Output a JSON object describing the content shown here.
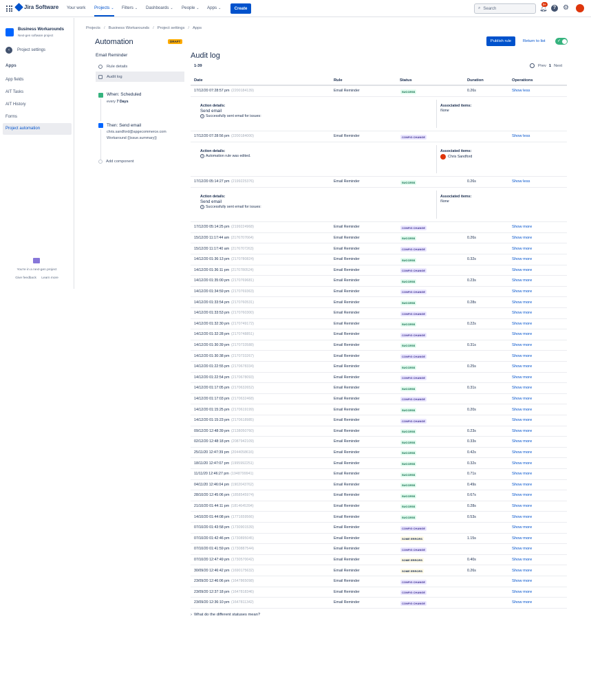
{
  "topnav": {
    "app_name": "Jira Software",
    "items": [
      {
        "label": "Your work",
        "caret": false
      },
      {
        "label": "Projects",
        "caret": true,
        "active": true
      },
      {
        "label": "Filters",
        "caret": true
      },
      {
        "label": "Dashboards",
        "caret": true
      },
      {
        "label": "People",
        "caret": true
      },
      {
        "label": "Apps",
        "caret": true
      }
    ],
    "create_label": "Create",
    "search_placeholder": "Search",
    "notif_count": "9+"
  },
  "sidebar": {
    "project_name": "Business Workarounds",
    "project_type": "Next-gen software project",
    "back_label": "Project settings",
    "section": "Apps",
    "items": [
      {
        "label": "App fields"
      },
      {
        "label": "AIT Tasks"
      },
      {
        "label": "AIT History"
      },
      {
        "label": "Forms"
      },
      {
        "label": "Project automation",
        "active": true
      }
    ],
    "nextgen_text": "You're in a next-gen project",
    "feedback_label": "Give feedback",
    "learn_label": "Learn more"
  },
  "breadcrumb": [
    "Projects",
    "Business Workarounds",
    "Project settings",
    "Apps"
  ],
  "header": {
    "title": "Automation",
    "draft": "DRAFT",
    "publish_label": "Publish rule",
    "return_label": "Return to list"
  },
  "rule": {
    "name": "Email Reminder",
    "nav": [
      {
        "label": "Rule details"
      },
      {
        "label": "Audit log",
        "active": true
      }
    ],
    "trigger_title": "When: Scheduled",
    "trigger_every": "every",
    "trigger_period": "7 Days",
    "action_title": "Then: Send email",
    "action_to": "chris.sandford@apgecommerce.com",
    "action_subject": "Workaround {{issue.summary}}",
    "add_component": "Add component"
  },
  "audit": {
    "title": "Audit log",
    "range": "1-39",
    "prev": "Prev",
    "page": "1",
    "next": "Next",
    "headers": {
      "date": "Date",
      "rule": "Rule",
      "status": "Status",
      "duration": "Duration",
      "operations": "Operations"
    },
    "rows": [
      {
        "date": "17/12/20 07:28:57 pm",
        "id": "(2200184139)",
        "rule": "Email Reminder",
        "status": "SUCCESS",
        "duration": "0.26s",
        "op": "Show less",
        "detail": {
          "label": "Action details:",
          "action": "Send email",
          "message": "Successfully sent email for issues:",
          "assoc_label": "Associated items:",
          "assoc": "None"
        }
      },
      {
        "date": "17/12/20 07:28:56 pm",
        "id": "(2200184000)",
        "rule": "Email Reminder",
        "status": "CONFIG CHANGE",
        "duration": "",
        "op": "Show less",
        "detail": {
          "label": "Action details:",
          "action": "",
          "message": "Automation rule was edited.",
          "assoc_label": "Associated items:",
          "user": "Chris Sandford"
        }
      },
      {
        "date": "17/12/20 05:14:27 pm",
        "id": "(2199225376)",
        "rule": "Email Reminder",
        "status": "SUCCESS",
        "duration": "0.26s",
        "op": "Show less",
        "detail": {
          "label": "Action details:",
          "action": "Send email",
          "message": "Successfully sent email for issues:",
          "assoc_label": "Associated items:",
          "assoc": "None"
        }
      },
      {
        "date": "17/12/20 05:14:25 pm",
        "id": "(2199224968)",
        "rule": "Email Reminder",
        "status": "CONFIG CHANGE",
        "duration": "",
        "op": "Show more"
      },
      {
        "date": "15/12/20 11:17:44 am",
        "id": "(2176707664)",
        "rule": "Email Reminder",
        "status": "SUCCESS",
        "duration": "0.26s",
        "op": "Show more"
      },
      {
        "date": "15/12/20 11:17:40 am",
        "id": "(2176707263)",
        "rule": "Email Reminder",
        "status": "CONFIG CHANGE",
        "duration": "",
        "op": "Show more"
      },
      {
        "date": "14/12/20 01:36:13 pm",
        "id": "(2170780824)",
        "rule": "Email Reminder",
        "status": "SUCCESS",
        "duration": "0.32s",
        "op": "Show more"
      },
      {
        "date": "14/12/20 01:36:11 pm",
        "id": "(2170780524)",
        "rule": "Email Reminder",
        "status": "CONFIG CHANGE",
        "duration": "",
        "op": "Show more"
      },
      {
        "date": "14/12/20 01:35:00 pm",
        "id": "(2170769681)",
        "rule": "Email Reminder",
        "status": "SUCCESS",
        "duration": "0.23s",
        "op": "Show more"
      },
      {
        "date": "14/12/20 01:34:59 pm",
        "id": "(2170769363)",
        "rule": "Email Reminder",
        "status": "CONFIG CHANGE",
        "duration": "",
        "op": "Show more"
      },
      {
        "date": "14/12/20 01:33:54 pm",
        "id": "(2170760531)",
        "rule": "Email Reminder",
        "status": "SUCCESS",
        "duration": "0.28s",
        "op": "Show more"
      },
      {
        "date": "14/12/20 01:33:53 pm",
        "id": "(2170760300)",
        "rule": "Email Reminder",
        "status": "CONFIG CHANGE",
        "duration": "",
        "op": "Show more"
      },
      {
        "date": "14/12/20 01:32:30 pm",
        "id": "(2170749172)",
        "rule": "Email Reminder",
        "status": "SUCCESS",
        "duration": "0.22s",
        "op": "Show more"
      },
      {
        "date": "14/12/20 01:32:28 pm",
        "id": "(2170748851)",
        "rule": "Email Reminder",
        "status": "CONFIG CHANGE",
        "duration": "",
        "op": "Show more"
      },
      {
        "date": "14/12/20 01:30:39 pm",
        "id": "(2170733588)",
        "rule": "Email Reminder",
        "status": "SUCCESS",
        "duration": "0.31s",
        "op": "Show more"
      },
      {
        "date": "14/12/20 01:30:38 pm",
        "id": "(2170733267)",
        "rule": "Email Reminder",
        "status": "CONFIG CHANGE",
        "duration": "",
        "op": "Show more"
      },
      {
        "date": "14/12/20 01:22:55 pm",
        "id": "(2170678334)",
        "rule": "Email Reminder",
        "status": "SUCCESS",
        "duration": "0.25s",
        "op": "Show more"
      },
      {
        "date": "14/12/20 01:22:54 pm",
        "id": "(2170678093)",
        "rule": "Email Reminder",
        "status": "CONFIG CHANGE",
        "duration": "",
        "op": "Show more"
      },
      {
        "date": "14/12/20 01:17:05 pm",
        "id": "(2170632652)",
        "rule": "Email Reminder",
        "status": "SUCCESS",
        "duration": "0.31s",
        "op": "Show more"
      },
      {
        "date": "14/12/20 01:17:03 pm",
        "id": "(2170632468)",
        "rule": "Email Reminder",
        "status": "CONFIG CHANGE",
        "duration": "",
        "op": "Show more"
      },
      {
        "date": "14/12/20 01:15:25 pm",
        "id": "(2170619199)",
        "rule": "Email Reminder",
        "status": "SUCCESS",
        "duration": "0.20s",
        "op": "Show more"
      },
      {
        "date": "14/12/20 01:15:23 pm",
        "id": "(2170618985)",
        "rule": "Email Reminder",
        "status": "CONFIG CHANGE",
        "duration": "",
        "op": "Show more"
      },
      {
        "date": "09/12/20 12:48:39 pm",
        "id": "(2138050760)",
        "rule": "Email Reminder",
        "status": "SUCCESS",
        "duration": "0.23s",
        "op": "Show more"
      },
      {
        "date": "02/12/20 12:48:18 pm",
        "id": "(2087942109)",
        "rule": "Email Reminder",
        "status": "SUCCESS",
        "duration": "0.33s",
        "op": "Show more"
      },
      {
        "date": "25/11/20 12:47:39 pm",
        "id": "(2044058616)",
        "rule": "Email Reminder",
        "status": "SUCCESS",
        "duration": "0.42s",
        "op": "Show more"
      },
      {
        "date": "18/11/20 12:47:07 pm",
        "id": "(1995992251)",
        "rule": "Email Reminder",
        "status": "SUCCESS",
        "duration": "0.32s",
        "op": "Show more"
      },
      {
        "date": "11/11/20 12:46:27 pm",
        "id": "(1948799941)",
        "rule": "Email Reminder",
        "status": "SUCCESS",
        "duration": "0.71s",
        "op": "Show more"
      },
      {
        "date": "04/11/20 12:46:04 pm",
        "id": "(1902043762)",
        "rule": "Email Reminder",
        "status": "SUCCESS",
        "duration": "0.49s",
        "op": "Show more"
      },
      {
        "date": "28/10/20 12:45:06 pm",
        "id": "(1858545974)",
        "rule": "Email Reminder",
        "status": "SUCCESS",
        "duration": "0.67s",
        "op": "Show more"
      },
      {
        "date": "21/10/20 01:44:11 pm",
        "id": "(1814645394)",
        "rule": "Email Reminder",
        "status": "SUCCESS",
        "duration": "0.28s",
        "op": "Show more"
      },
      {
        "date": "14/10/20 01:44:08 pm",
        "id": "(1771659566)",
        "rule": "Email Reminder",
        "status": "SUCCESS",
        "duration": "0.53s",
        "op": "Show more"
      },
      {
        "date": "07/10/20 01:43:58 pm",
        "id": "(1730901539)",
        "rule": "Email Reminder",
        "status": "CONFIG CHANGE",
        "duration": "",
        "op": "Show more"
      },
      {
        "date": "07/10/20 01:42:46 pm",
        "id": "(1730895045)",
        "rule": "Email Reminder",
        "status": "SOME ERRORS",
        "duration": "1.15s",
        "op": "Show more"
      },
      {
        "date": "07/10/20 01:41:59 pm",
        "id": "(1730887544)",
        "rule": "Email Reminder",
        "status": "CONFIG CHANGE",
        "duration": "",
        "op": "Show more"
      },
      {
        "date": "07/10/20 12:47:49 pm",
        "id": "(1730570042)",
        "rule": "Email Reminder",
        "status": "SOME ERRORS",
        "duration": "0.40s",
        "op": "Show more"
      },
      {
        "date": "30/09/20 12:46:42 pm",
        "id": "(1690175632)",
        "rule": "Email Reminder",
        "status": "SOME ERRORS",
        "duration": "0.26s",
        "op": "Show more"
      },
      {
        "date": "23/09/20 12:46:06 pm",
        "id": "(1647865098)",
        "rule": "Email Reminder",
        "status": "CONFIG CHANGE",
        "duration": "",
        "op": "Show more"
      },
      {
        "date": "23/09/20 12:37:18 pm",
        "id": "(1647818346)",
        "rule": "Email Reminder",
        "status": "CONFIG CHANGE",
        "duration": "",
        "op": "Show more"
      },
      {
        "date": "23/09/20 12:36:10 pm",
        "id": "(1647811342)",
        "rule": "Email Reminder",
        "status": "CONFIG CHANGE",
        "duration": "",
        "op": "Show more"
      }
    ],
    "statuses_question": "What do the different statuses mean?"
  }
}
